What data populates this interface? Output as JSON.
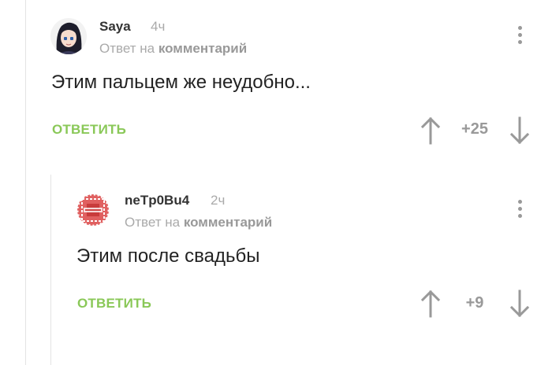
{
  "comments": [
    {
      "author": "Saya",
      "time": "4ч",
      "reply_prefix": "Ответ на",
      "reply_target": "комментарий",
      "text": "Этим пальцем же неудобно...",
      "reply_label": "ОТВЕТИТЬ",
      "rating": "+25"
    },
    {
      "author": "neTp0Bu4",
      "time": "2ч",
      "reply_prefix": "Ответ на",
      "reply_target": "комментарий",
      "text": "Этим после свадьбы",
      "reply_label": "ОТВЕТИТЬ",
      "rating": "+9"
    }
  ],
  "colors": {
    "accent_green": "#8ac858",
    "muted_gray": "#999999",
    "thread_line": "#e4e4e4"
  },
  "icons": {
    "upvote": "arrow-up-icon",
    "downvote": "arrow-down-icon",
    "menu": "more-vertical-icon"
  }
}
